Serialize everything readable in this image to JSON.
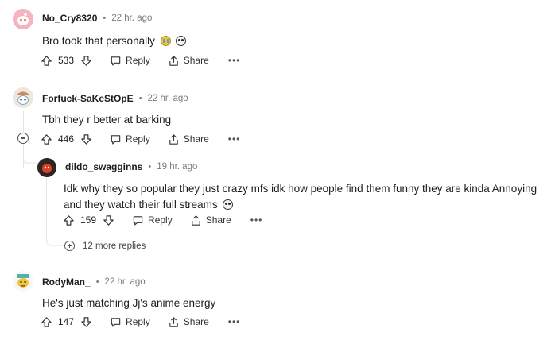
{
  "comments": [
    {
      "username": "No_Cry8320",
      "dot": "•",
      "time": "22 hr. ago",
      "text": "Bro took that personally",
      "emojis": [
        "loudly-crying-face-emoji",
        "skull-emoji"
      ],
      "score": "533",
      "reply_label": "Reply",
      "share_label": "Share",
      "more_label": "•••"
    },
    {
      "username": "Forfuck-SaKeStOpE",
      "dot": "•",
      "time": "22 hr. ago",
      "text": "Tbh they r better at barking",
      "score": "446",
      "reply_label": "Reply",
      "share_label": "Share",
      "more_label": "•••",
      "replies": [
        {
          "username": "dildo_swagginns",
          "dot": "•",
          "time": "19 hr. ago",
          "text": "Idk why they so popular they just crazy mfs idk how people find them funny they are kinda Annoying and they watch their full streams",
          "emojis": [
            "skull-emoji"
          ],
          "score": "159",
          "reply_label": "Reply",
          "share_label": "Share",
          "more_label": "•••"
        }
      ],
      "more_replies_label": "12 more replies"
    },
    {
      "username": "RodyMan_",
      "dot": "•",
      "time": "22 hr. ago",
      "text": "He's just matching Jj's anime energy",
      "score": "147",
      "reply_label": "Reply",
      "share_label": "Share",
      "more_label": "•••"
    }
  ],
  "colors": {
    "text": "#1c1c1c",
    "meta": "#7c7c7c",
    "thread_line": "#e5e5e5",
    "avatar1": "#f2a8b8",
    "avatar2": "#c98b5a",
    "avatar3": "#d9412b",
    "avatar4": "#f0c53a"
  }
}
